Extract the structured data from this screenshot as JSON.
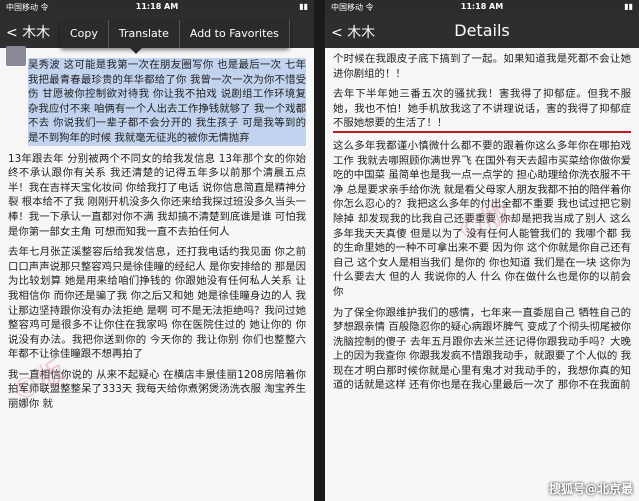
{
  "left": {
    "status": {
      "carrier": "中国移动 令",
      "time": "11:18 AM",
      "battery": "▮▮"
    },
    "nav": {
      "back": "< 木木",
      "user_tag": "木木"
    },
    "menu": {
      "copy": "Copy",
      "translate": "Translate",
      "favorites": "Add to Favorites"
    },
    "paras": [
      "吴秀波 这可能是我第一次在朋友圈写你 也是最后一次 七年 我把最青春最珍贵的年华都给了你 我曾一次一次为你不惜受伤 甘愿被你控制欲对待我 你让我不拍戏 说剧组工作环境复杂我应付不来 咱俩有一个人出去工作挣钱就够了 我一个戏都不去 你说我们一辈子都不会分开的 我生孩子 可是我等到的是不到狗年的时候 我就毫无征兆的被你无情抛弃",
      "13年跟去年 分别被两个不同女的给我发信息 13年那个女的你始终不承认跟你有关系 我还清楚的记得五年多以前那个清晨五点半！我在吉祥天宝化妆间 你给我打了电话 说你信息简直是精神分裂 根本给不了我 刚刚开机没多久你还来给我探过班没多久当头一棒！我一下承认一直都对你不满 我却搞不清楚到底谁是谁 可怕我是你第一部女主角 可想而知我一直不去拍任何人",
      "去年七月张芷溪整容后给我发信息，还打我电话约我见面 你之前口口声声说那只整容鸡只是徐佳瞳的经纪人 是你安排给的 那是因为比较划算 她是用来给咱们挣钱的 你跟她没有任何私人关系 让我相信你 而你还是骗了我 你之后又和她 她是徐佳瞳身边的人 我让那边坚持跟你没有办法拒绝 是啊 可不是无法拒绝吗？我问过她整容鸡可是很多不让你住在我家吗 你在医院住过的 她让你的 你说没有办法。我把你送到你的 今天你的 我让你别 你们也整整六年都不让徐佳瞳跟不想再拍了",
      "我一直相信你说的 从来不起疑心 在横店丰景佳丽1208房陪着你拍军师联盟整整呆了333天 我每天给你煮粥煲汤洗衣服 淘宝养生丽娜你 就"
    ]
  },
  "right": {
    "status": {
      "carrier": "中国移动 令",
      "time": "11:18 AM",
      "battery": "▮▮"
    },
    "nav": {
      "back": "< 木木",
      "title": "Details"
    },
    "paras": [
      "个时候在我跟皮子底下搞到了一起。如果知道我是死都不会让她进你剧组的！！",
      "去年下半年她三番五次的骚扰我！害我得了抑郁症。但我不服她，我也不怕！她手机放我这了不讲理说话，害的我得了抑郁症不服她想要的生活了！！",
      "这么多年我都谨小慎微什么都不要的跟着你这么多年你在哪拍戏工作 我就去哪照顾你满世界飞 在国外有天去超市买菜给你做你爱吃的中国菜 虽简单也是我一点一点学的 担心助理给你洗衣服不干净 总是要求亲手给你洗 就是看父母家人朋友我都不拍的陪伴着你 你怎么忍心的？我把这么多年的付出全都不重要 我也试过把它剔除掉 却发现我的比我自己还要重要 你却是把我当成了别人 这么多年我天天真傻 但是以为了 没有任何人能管我们的 我哪个都 我的生命里她的一种不可拿出来不要 因为你 这个你就是你自己还有自己 这个女人是相当我们 是你的 你也知道 我们是在一块 这你为什么要去大 但的人 我说你的人 什么 你在做什么也是你的以前会你",
      "为了保全你跟维护我们的感情，七年来一直委屈自己 牺牲自己的梦想跟亲情 百般隐忍你的疑心病跟坏脾气 变成了个彻头彻尾被你洗脑控制的傻子 去年五月跟你去米兰还记得你跟我动手吗？大晚上的因为我查你 你跟我发疯不惜跟我动手，就跟要了个人似的 我现在才明白那时候你就是心里有鬼才对我动手的，我想你真的知道的话就是这样 还有你也是在我心里最后一次了 那你不在我面前"
    ],
    "corner_mark": "搜狐号@北京最"
  },
  "watermark": "©版"
}
